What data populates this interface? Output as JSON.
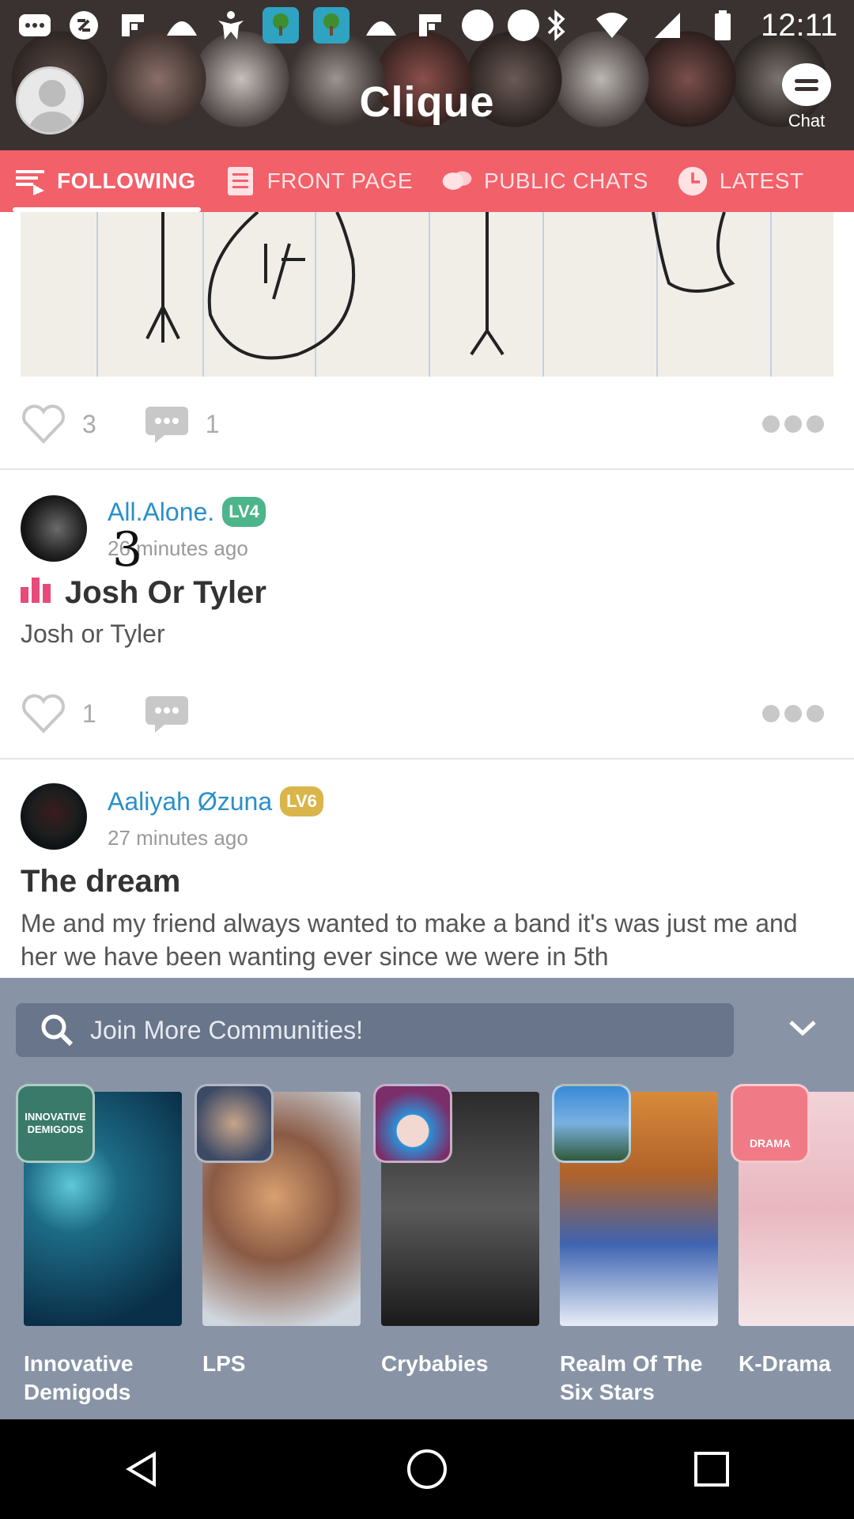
{
  "status_bar": {
    "time": "12:11",
    "left_icons": [
      "message-icon",
      "sync-icon",
      "flipboard-icon",
      "seashell-icon",
      "person-icon",
      "tree-app-icon",
      "tree-app-icon",
      "seashell-icon",
      "flipboard-icon",
      "dot-icon",
      "dot-icon"
    ],
    "right_icons": [
      "bluetooth-icon",
      "wifi-icon",
      "signal-icon",
      "battery-icon"
    ]
  },
  "header": {
    "title": "Clique",
    "chat_label": "Chat"
  },
  "tabs": [
    {
      "label": "FOLLOWING",
      "icon": "list-icon",
      "active": true
    },
    {
      "label": "FRONT PAGE",
      "icon": "page-icon",
      "active": false
    },
    {
      "label": "PUBLIC CHATS",
      "icon": "chat-bubbles-icon",
      "active": false
    },
    {
      "label": "LATEST",
      "icon": "clock-icon",
      "active": false
    }
  ],
  "posts": [
    {
      "likes": "3",
      "comments": "1"
    },
    {
      "username": "All.Alone.",
      "level": "LV4",
      "level_color": "#4cb58a",
      "overlay_number": "3",
      "time": "26 minutes ago",
      "title": "Josh Or Tyler",
      "title_icon": "poll-icon",
      "body": "Josh or Tyler",
      "likes": "1"
    },
    {
      "username": "Aaliyah Øzuna",
      "level": "LV6",
      "level_color": "#d9b54a",
      "time": "27 minutes ago",
      "title": "The dream",
      "body": "Me and my friend always wanted to make a band it's was just me and her we have been wanting ever since we were in 5th"
    }
  ],
  "communities": {
    "search_placeholder": "Join More Communities!",
    "items": [
      {
        "name": "Innovative Demigods",
        "thumb_text": "INNOVATIVE DEMIGODS"
      },
      {
        "name": "LPS"
      },
      {
        "name": "Crybabies"
      },
      {
        "name": "Realm Of The Six Stars"
      },
      {
        "name": "K-Drama",
        "thumb_text": "DRAMA"
      }
    ]
  },
  "colors": {
    "accent": "#f2606a",
    "link": "#2a8fc9",
    "panel": "#8894a6"
  }
}
